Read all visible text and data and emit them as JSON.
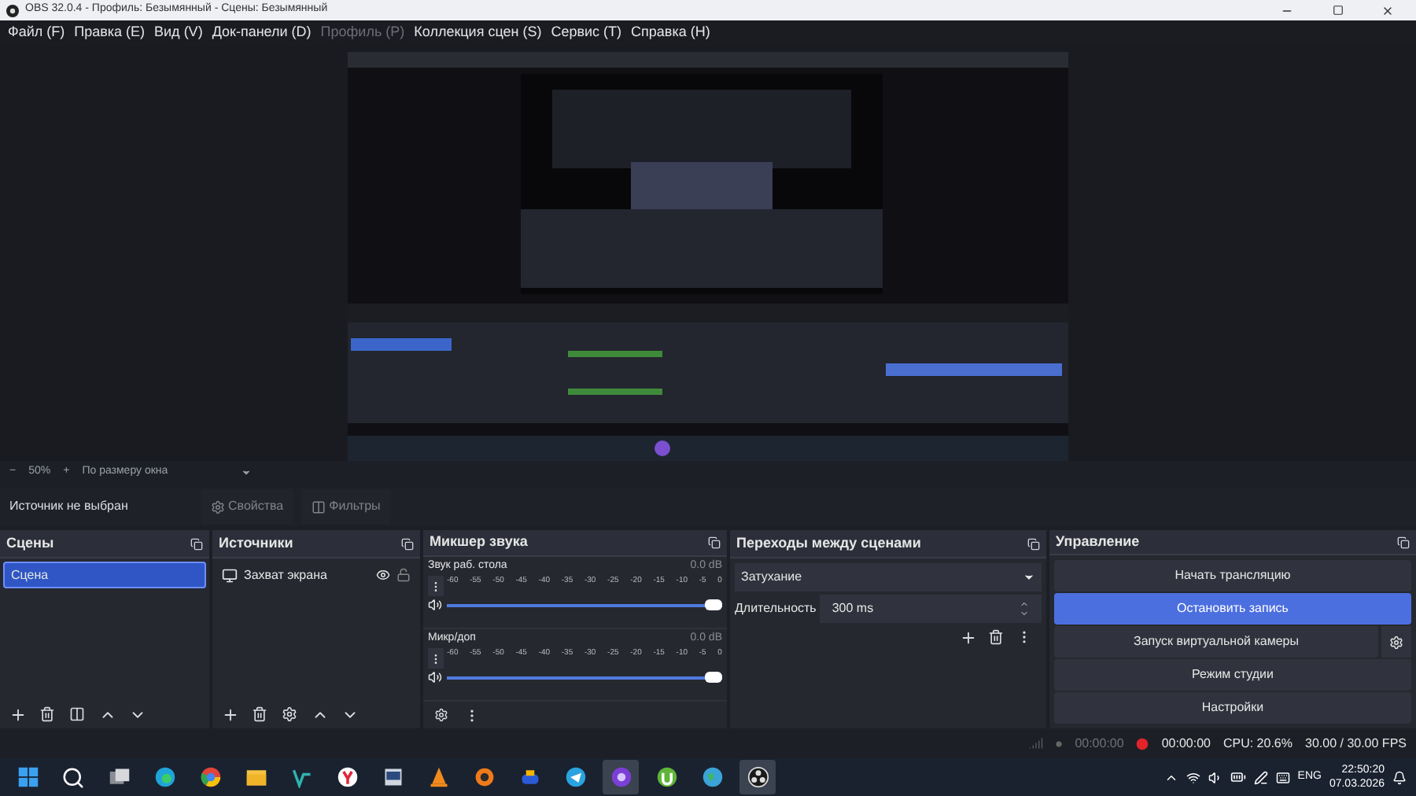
{
  "window": {
    "title": "OBS 32.0.4 - Профиль: Безымянный - Сцены: Безымянный"
  },
  "menu": [
    {
      "label": "Файл (F)",
      "disabled": false
    },
    {
      "label": "Правка (E)",
      "disabled": false
    },
    {
      "label": "Вид (V)",
      "disabled": false
    },
    {
      "label": "Док-панели (D)",
      "disabled": false
    },
    {
      "label": "Профиль (P)",
      "disabled": true
    },
    {
      "label": "Коллекция сцен (S)",
      "disabled": false
    },
    {
      "label": "Сервис (T)",
      "disabled": false
    },
    {
      "label": "Справка (H)",
      "disabled": false
    }
  ],
  "zoom_bar": {
    "minus": "−",
    "zoom": "50%",
    "plus": "+",
    "fit": "По размеру окна"
  },
  "source_toolbar": {
    "status": "Источник не выбран",
    "properties": "Свойства",
    "filters": "Фильтры"
  },
  "scenes": {
    "title": "Сцены",
    "items": [
      {
        "label": "Сцена",
        "selected": true
      }
    ]
  },
  "sources": {
    "title": "Источники",
    "items": [
      {
        "label": "Захват экрана",
        "visible": true,
        "locked": false
      }
    ]
  },
  "mixer": {
    "title": "Микшер звука",
    "channels": [
      {
        "name": "Звук раб. стола",
        "reading": "0.0 dB",
        "muted": false,
        "level": 1,
        "scale": [
          "-60",
          "-55",
          "-50",
          "-45",
          "-40",
          "-35",
          "-30",
          "-25",
          "-20",
          "-15",
          "-10",
          "-5",
          "0"
        ]
      },
      {
        "name": "Микр/доп",
        "reading": "0.0 dB",
        "muted": false,
        "level": 1,
        "scale": [
          "-60",
          "-55",
          "-50",
          "-45",
          "-40",
          "-35",
          "-30",
          "-25",
          "-20",
          "-15",
          "-10",
          "-5",
          "0"
        ]
      }
    ]
  },
  "transitions": {
    "title": "Переходы между сценами",
    "transition": "Затухание",
    "duration_label": "Длительность",
    "duration": "300 ms"
  },
  "controls": {
    "title": "Управление",
    "buttons": [
      {
        "label": "Начать трансляцию",
        "active": false,
        "settings": false
      },
      {
        "label": "Остановить запись",
        "active": true,
        "settings": false
      },
      {
        "label": "Запуск виртуальной камеры",
        "active": false,
        "settings": true
      },
      {
        "label": "Режим студии",
        "active": false,
        "settings": false
      },
      {
        "label": "Настройки",
        "active": false,
        "settings": false
      }
    ]
  },
  "status_bar": {
    "stream_time": "00:00:00",
    "record_time": "00:00:00",
    "cpu": "CPU: 20.6%",
    "fps": "30.00 / 30.00 FPS"
  },
  "taskbar": {
    "apps": [
      {
        "selected": false
      },
      {
        "selected": false
      },
      {
        "selected": false
      },
      {
        "selected": false
      },
      {
        "selected": false
      },
      {
        "selected": false
      },
      {
        "selected": false
      },
      {
        "selected": false
      },
      {
        "selected": false
      },
      {
        "selected": false
      },
      {
        "selected": false
      },
      {
        "selected": false
      },
      {
        "selected": false
      },
      {
        "selected": true
      },
      {
        "selected": false
      },
      {
        "selected": false
      },
      {
        "selected": true
      }
    ],
    "language": "ENG",
    "time": "22:50:20",
    "date": "07.03.2026"
  }
}
